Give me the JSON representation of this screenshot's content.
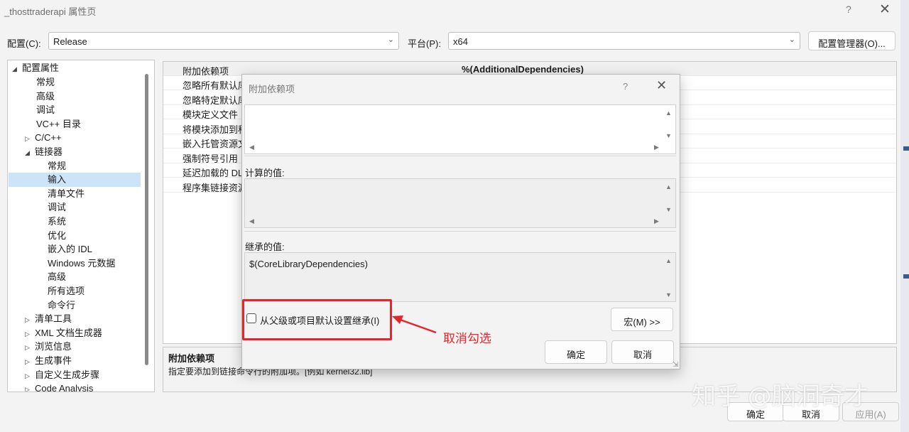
{
  "window": {
    "title": "_thosttraderapi 属性页",
    "help_glyph": "?",
    "close_glyph": "✕"
  },
  "config": {
    "config_label": "配置(C):",
    "config_value": "Release",
    "platform_label": "平台(P):",
    "platform_value": "x64",
    "manager_button": "配置管理器(O)..."
  },
  "tree": {
    "root": "配置属性",
    "items": [
      {
        "label": "常规"
      },
      {
        "label": "高级"
      },
      {
        "label": "调试"
      },
      {
        "label": "VC++ 目录"
      },
      {
        "label": "C/C++"
      },
      {
        "label": "链接器"
      },
      {
        "label": "常规"
      },
      {
        "label": "输入"
      },
      {
        "label": "清单文件"
      },
      {
        "label": "调试"
      },
      {
        "label": "系统"
      },
      {
        "label": "优化"
      },
      {
        "label": "嵌入的 IDL"
      },
      {
        "label": "Windows 元数据"
      },
      {
        "label": "高级"
      },
      {
        "label": "所有选项"
      },
      {
        "label": "命令行"
      },
      {
        "label": "清单工具"
      },
      {
        "label": "XML 文档生成器"
      },
      {
        "label": "浏览信息"
      },
      {
        "label": "生成事件"
      },
      {
        "label": "自定义生成步骤"
      },
      {
        "label": "Code Analysis"
      }
    ]
  },
  "grid": {
    "rows": [
      {
        "name": "附加依赖项",
        "value": "%(AdditionalDependencies)"
      },
      {
        "name": "忽略所有默认库",
        "value": ""
      },
      {
        "name": "忽略特定默认库",
        "value": ""
      },
      {
        "name": "模块定义文件",
        "value": ""
      },
      {
        "name": "将模块添加到程序集",
        "value": ""
      },
      {
        "name": "嵌入托管资源文件",
        "value": ""
      },
      {
        "name": "强制符号引用",
        "value": ""
      },
      {
        "name": "延迟加载的 DLL",
        "value": ""
      },
      {
        "name": "程序集链接资源",
        "value": ""
      }
    ]
  },
  "description": {
    "title": "附加依赖项",
    "text": "指定要添加到链接命令行的附加项。[例如 kernel32.lib]"
  },
  "bottom_buttons": {
    "ok": "确定",
    "cancel": "取消",
    "apply": "应用(A)"
  },
  "dialog": {
    "title": "附加依赖项",
    "help_glyph": "?",
    "close_glyph": "✕",
    "edit_value": "",
    "computed_label": "计算的值:",
    "computed_value": "",
    "inherited_label": "继承的值:",
    "inherited_value": "$(CoreLibraryDependencies)",
    "inherit_checkbox_label": "从父级或项目默认设置继承(I)",
    "inherit_checked": false,
    "macro_button": "宏(M) >>",
    "ok_button": "确定",
    "cancel_button": "取消"
  },
  "annotation": {
    "text": "取消勾选",
    "color": "#e4262c"
  },
  "watermark": "知乎 @脑洞奇才",
  "colors": {
    "selection": "#cce4f7",
    "annotation_red": "#e4262c"
  }
}
